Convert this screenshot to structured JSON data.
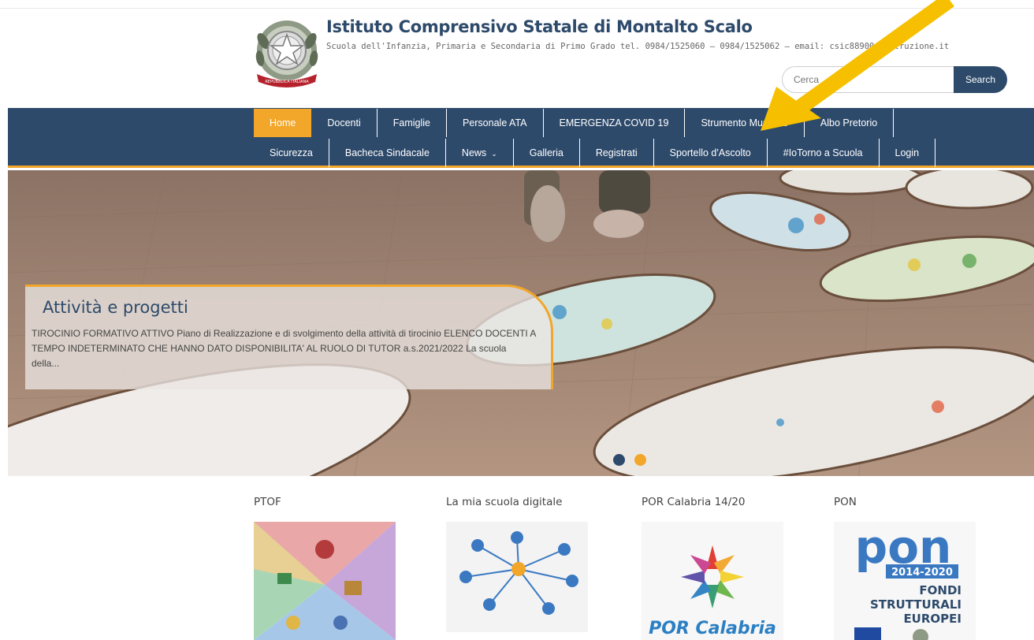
{
  "header": {
    "title": "Istituto Comprensivo Statale di Montalto Scalo",
    "subtitle": "Scuola dell'Infanzia, Primaria e Secondaria di Primo Grado tel. 0984/1525060 – 0984/1525062 – email: csic88900d@istruzione.it",
    "emblem_text": "REPUBBLICA ITALIANA",
    "emblem_icon": "italian-republic-emblem"
  },
  "search": {
    "placeholder": "Cerca",
    "button_label": "Search"
  },
  "nav": {
    "row1": [
      {
        "label": "Home",
        "active": true
      },
      {
        "label": "Docenti"
      },
      {
        "label": "Famiglie"
      },
      {
        "label": "Personale ATA"
      },
      {
        "label": "EMERGENZA COVID 19"
      },
      {
        "label": "Strumento Musicale"
      },
      {
        "label": "Albo Pretorio"
      }
    ],
    "row2": [
      {
        "label": "Sicurezza"
      },
      {
        "label": "Bacheca Sindacale"
      },
      {
        "label": "News",
        "dropdown": true
      },
      {
        "label": "Galleria"
      },
      {
        "label": "Registrati"
      },
      {
        "label": "Sportello d'Ascolto"
      },
      {
        "label": "#IoTorno a Scuola"
      },
      {
        "label": "Login"
      }
    ]
  },
  "slider": {
    "title": "Attività e progetti",
    "text": "TIROCINIO FORMATIVO ATTIVO Piano di Realizzazione e di svolgimento della attività di tirocinio ELENCO DOCENTI A TEMPO INDETERMINATO CHE HANNO DATO DISPONIBILITA' AL RUOLO DI TUTOR a.s.2021/2022 La scuola della...",
    "slide_count": 2,
    "active_slide": 2
  },
  "widgets": [
    {
      "title": "PTOF",
      "image": "ptof-image"
    },
    {
      "title": "La mia scuola digitale",
      "image": "network-image"
    },
    {
      "title": "POR Calabria 14/20",
      "image": "por-calabria-logo",
      "logo_text": "POR Calabria"
    },
    {
      "title": "PON",
      "image": "pon-logo",
      "logo_text": "pon",
      "logo_years": "2014-2020",
      "logo_line1": "FONDI",
      "logo_line2": "STRUTTURALI",
      "logo_line3": "EUROPEI"
    }
  ],
  "colors": {
    "primary": "#2e4a6b",
    "accent": "#f2a62a",
    "annotation_arrow": "#f6c000"
  }
}
